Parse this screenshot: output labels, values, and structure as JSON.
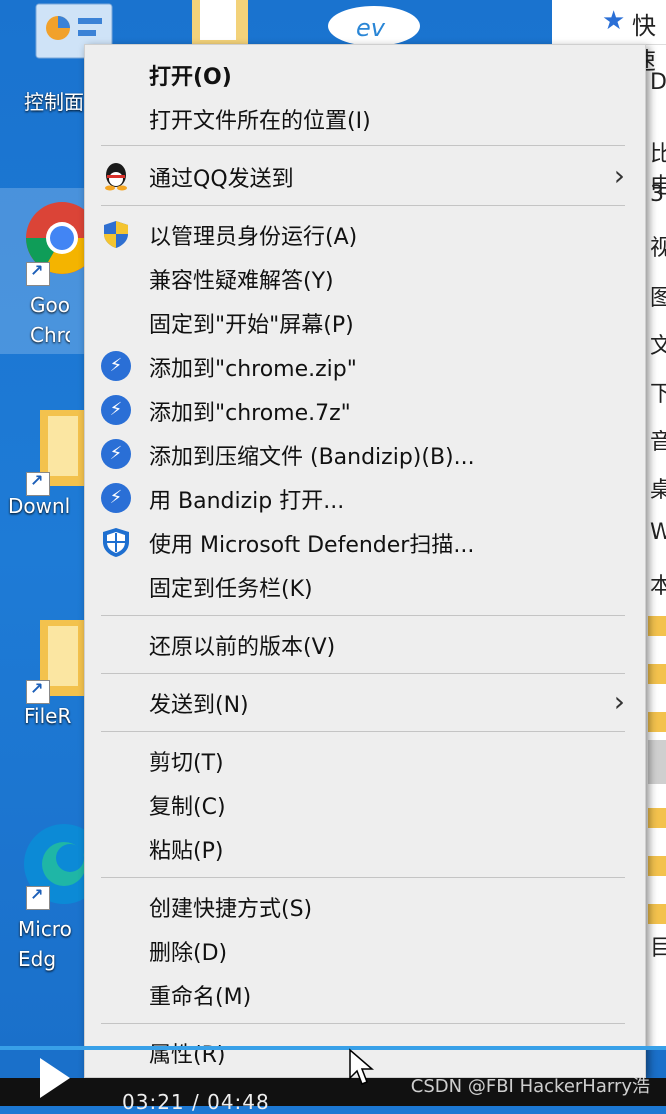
{
  "desktop": {
    "icons": [
      {
        "label": "控制面"
      },
      {
        "label": "Goo Chro"
      },
      {
        "label": "Downl"
      },
      {
        "label": "FileR"
      },
      {
        "label": "Micro Edg"
      }
    ]
  },
  "right_panel": {
    "header": "快速",
    "lines": [
      "Dn",
      "比电",
      "3",
      "视",
      "图",
      "文",
      "下",
      "音",
      "桌",
      "W",
      "本",
      "目"
    ]
  },
  "context_menu": {
    "items": [
      {
        "label": "打开(O)"
      },
      {
        "label": "打开文件所在的位置(I)"
      },
      {
        "label": "通过QQ发送到"
      },
      {
        "label": "以管理员身份运行(A)"
      },
      {
        "label": "兼容性疑难解答(Y)"
      },
      {
        "label": "固定到\"开始\"屏幕(P)"
      },
      {
        "label": "添加到\"chrome.zip\""
      },
      {
        "label": "添加到\"chrome.7z\""
      },
      {
        "label": "添加到压缩文件 (Bandizip)(B)..."
      },
      {
        "label": "用 Bandizip 打开..."
      },
      {
        "label": "使用 Microsoft Defender扫描..."
      },
      {
        "label": "固定到任务栏(K)"
      },
      {
        "label": "还原以前的版本(V)"
      },
      {
        "label": "发送到(N)"
      },
      {
        "label": "剪切(T)"
      },
      {
        "label": "复制(C)"
      },
      {
        "label": "粘贴(P)"
      },
      {
        "label": "创建快捷方式(S)"
      },
      {
        "label": "删除(D)"
      },
      {
        "label": "重命名(M)"
      },
      {
        "label": "属性(R)"
      }
    ]
  },
  "video": {
    "timecode": "03:21 / 04:48",
    "watermark": "CSDN @FBI HackerHarry浩"
  }
}
